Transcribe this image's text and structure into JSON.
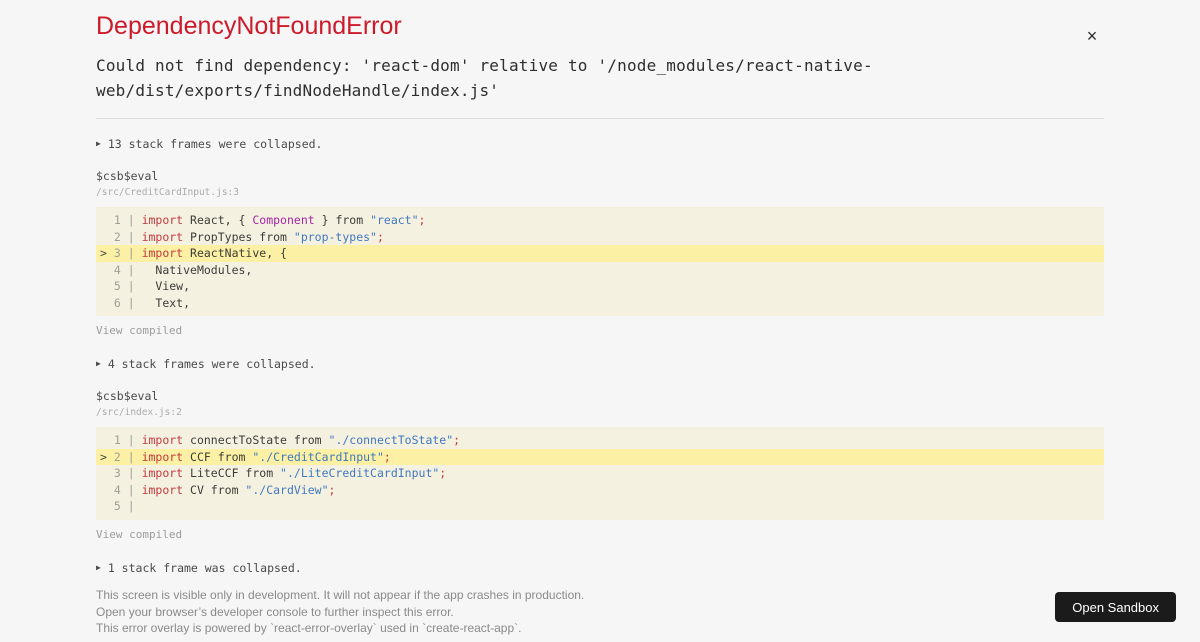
{
  "header": {
    "title": "DependencyNotFoundError",
    "close_icon": "×",
    "message": "Could not find dependency: 'react-dom' relative to '/node_modules/react-native-web/dist/exports/findNodeHandle/index.js'"
  },
  "icons": {
    "disclosure_triangle": "▶"
  },
  "colors": {
    "title_red": "#cd1a2b",
    "page_background": "#f6f6f6",
    "code_background": "#f5f1e1",
    "code_highlight": "#fbf0a4",
    "keyword": "#c5393f",
    "string": "#4078bf",
    "component": "#a626a4",
    "button_background": "#1b1b1b"
  },
  "stack": {
    "sections": [
      {
        "kind": "collapsed",
        "text": "13 stack frames were collapsed."
      },
      {
        "kind": "frame",
        "fn": "$csb$eval",
        "file": "/src/CreditCardInput.js:3",
        "link": "View compiled",
        "code": {
          "lines": [
            {
              "no": 1,
              "marker": false,
              "hl": false,
              "tokens": [
                [
                  "kw",
                  "import"
                ],
                [
                  "pl",
                  " React, { "
                ],
                [
                  "cp",
                  "Component"
                ],
                [
                  "pl",
                  " } from "
                ],
                [
                  "st",
                  "\"react\""
                ],
                [
                  "kw",
                  ";"
                ]
              ]
            },
            {
              "no": 2,
              "marker": false,
              "hl": false,
              "tokens": [
                [
                  "kw",
                  "import"
                ],
                [
                  "pl",
                  " PropTypes from "
                ],
                [
                  "st",
                  "\"prop-types\""
                ],
                [
                  "kw",
                  ";"
                ]
              ]
            },
            {
              "no": 3,
              "marker": true,
              "hl": true,
              "tokens": [
                [
                  "kw",
                  "import"
                ],
                [
                  "pl",
                  " ReactNative, {"
                ]
              ]
            },
            {
              "no": 4,
              "marker": false,
              "hl": false,
              "tokens": [
                [
                  "pl",
                  "  NativeModules,"
                ]
              ]
            },
            {
              "no": 5,
              "marker": false,
              "hl": false,
              "tokens": [
                [
                  "pl",
                  "  View,"
                ]
              ]
            },
            {
              "no": 6,
              "marker": false,
              "hl": false,
              "tokens": [
                [
                  "pl",
                  "  Text,"
                ]
              ]
            }
          ]
        }
      },
      {
        "kind": "collapsed",
        "text": "4 stack frames were collapsed."
      },
      {
        "kind": "frame",
        "fn": "$csb$eval",
        "file": "/src/index.js:2",
        "link": "View compiled",
        "code": {
          "lines": [
            {
              "no": 1,
              "marker": false,
              "hl": false,
              "tokens": [
                [
                  "kw",
                  "import"
                ],
                [
                  "pl",
                  " connectToState from "
                ],
                [
                  "st",
                  "\"./connectToState\""
                ],
                [
                  "kw",
                  ";"
                ]
              ]
            },
            {
              "no": 2,
              "marker": true,
              "hl": true,
              "tokens": [
                [
                  "kw",
                  "import"
                ],
                [
                  "pl",
                  " CCF from "
                ],
                [
                  "st",
                  "\"./CreditCardInput\""
                ],
                [
                  "kw",
                  ";"
                ]
              ]
            },
            {
              "no": 3,
              "marker": false,
              "hl": false,
              "tokens": [
                [
                  "kw",
                  "import"
                ],
                [
                  "pl",
                  " LiteCCF from "
                ],
                [
                  "st",
                  "\"./LiteCreditCardInput\""
                ],
                [
                  "kw",
                  ";"
                ]
              ]
            },
            {
              "no": 4,
              "marker": false,
              "hl": false,
              "tokens": [
                [
                  "kw",
                  "import"
                ],
                [
                  "pl",
                  " CV from "
                ],
                [
                  "st",
                  "\"./CardView\""
                ],
                [
                  "kw",
                  ";"
                ]
              ]
            },
            {
              "no": 5,
              "marker": false,
              "hl": false,
              "tokens": []
            }
          ]
        }
      },
      {
        "kind": "collapsed",
        "text": "1 stack frame was collapsed."
      }
    ]
  },
  "footer": {
    "lines": [
      "This screen is visible only in development. It will not appear if the app crashes in production.",
      "Open your browser’s developer console to further inspect this error.",
      "This error overlay is powered by `react-error-overlay` used in `create-react-app`."
    ],
    "button_label": "Open Sandbox"
  }
}
